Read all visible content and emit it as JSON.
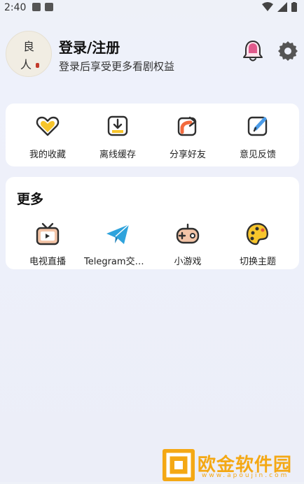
{
  "status_bar": {
    "time": "2:40"
  },
  "profile": {
    "avatar_chars": [
      "良",
      "人"
    ],
    "title": "登录/注册",
    "subtitle": "登录后享受更多看剧权益"
  },
  "quick_actions": [
    {
      "label": "我的收藏",
      "icon": "heart-icon"
    },
    {
      "label": "离线缓存",
      "icon": "download-icon"
    },
    {
      "label": "分享好友",
      "icon": "share-icon"
    },
    {
      "label": "意见反馈",
      "icon": "feedback-icon"
    }
  ],
  "more": {
    "title": "更多",
    "items": [
      {
        "label": "电视直播",
        "icon": "tv-icon"
      },
      {
        "label": "Telegram交流群",
        "icon": "telegram-icon"
      },
      {
        "label": "小游戏",
        "icon": "gamepad-icon"
      },
      {
        "label": "切换主题",
        "icon": "palette-icon"
      }
    ]
  },
  "watermark": {
    "text": "欧金软件园",
    "url": "www.apoujin.com"
  },
  "colors": {
    "accent_yellow": "#f7c52c",
    "icon_outline": "#2f2f2f",
    "bell_pink": "#e05a8c",
    "watermark": "#f4a814"
  }
}
